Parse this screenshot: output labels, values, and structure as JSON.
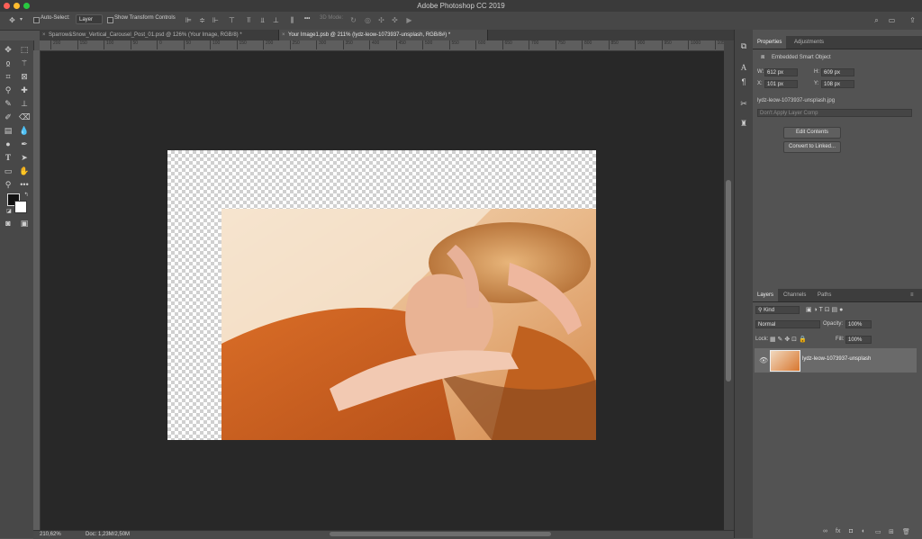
{
  "app": {
    "title": "Adobe Photoshop CC 2019"
  },
  "options_bar": {
    "auto_select_label": "Auto-Select:",
    "auto_select_target": "Layer",
    "show_transform_label": "Show Transform Controls",
    "three_d_mode_label": "3D Mode:",
    "more_label": "•••"
  },
  "tabs": [
    {
      "label": "Sparrow&Snow_Vertical_Carousel_Post_01.psd @ 126% (Your Image, RGB/8) *",
      "close": "×"
    },
    {
      "label": "Your Image1.psb @ 211% (lydz-leow-1073937-unsplash, RGB/8#) *",
      "close": "×"
    }
  ],
  "ruler": {
    "h_ticks": [
      "200",
      "150",
      "100",
      "50",
      "0",
      "50",
      "100",
      "150",
      "200",
      "250",
      "300",
      "350",
      "400",
      "450",
      "500",
      "550",
      "600",
      "650",
      "700",
      "750",
      "800",
      "850",
      "900",
      "950",
      "1000",
      "1050"
    ]
  },
  "status": {
    "zoom": "210,62%",
    "doc": "Doc: 1,23M/2,50M"
  },
  "properties": {
    "tabs": [
      "Properties",
      "Adjustments"
    ],
    "object_type": "Embedded Smart Object",
    "w_label": "W:",
    "w_value": "612 px",
    "h_label": "H:",
    "h_value": "609 px",
    "x_label": "X:",
    "x_value": "101 px",
    "y_label": "Y:",
    "y_value": "108 px",
    "filename": "lydz-leow-1073937-unsplash.jpg",
    "layer_comp_placeholder": "Don't Apply Layer Comp",
    "edit_contents": "Edit Contents",
    "convert_linked": "Convert to Linked..."
  },
  "layers": {
    "tabs": [
      "Layers",
      "Channels",
      "Paths"
    ],
    "filter_kind": "Kind",
    "blend_mode": "Normal",
    "opacity_label": "Opacity:",
    "opacity_value": "100%",
    "lock_label": "Lock:",
    "fill_label": "Fill:",
    "fill_value": "100%",
    "items": [
      {
        "name": "lydz-leow-1073937-unsplash"
      }
    ]
  },
  "colors": {
    "accent": "#f0a34a",
    "panel": "#535353",
    "canvas": "#282828"
  }
}
